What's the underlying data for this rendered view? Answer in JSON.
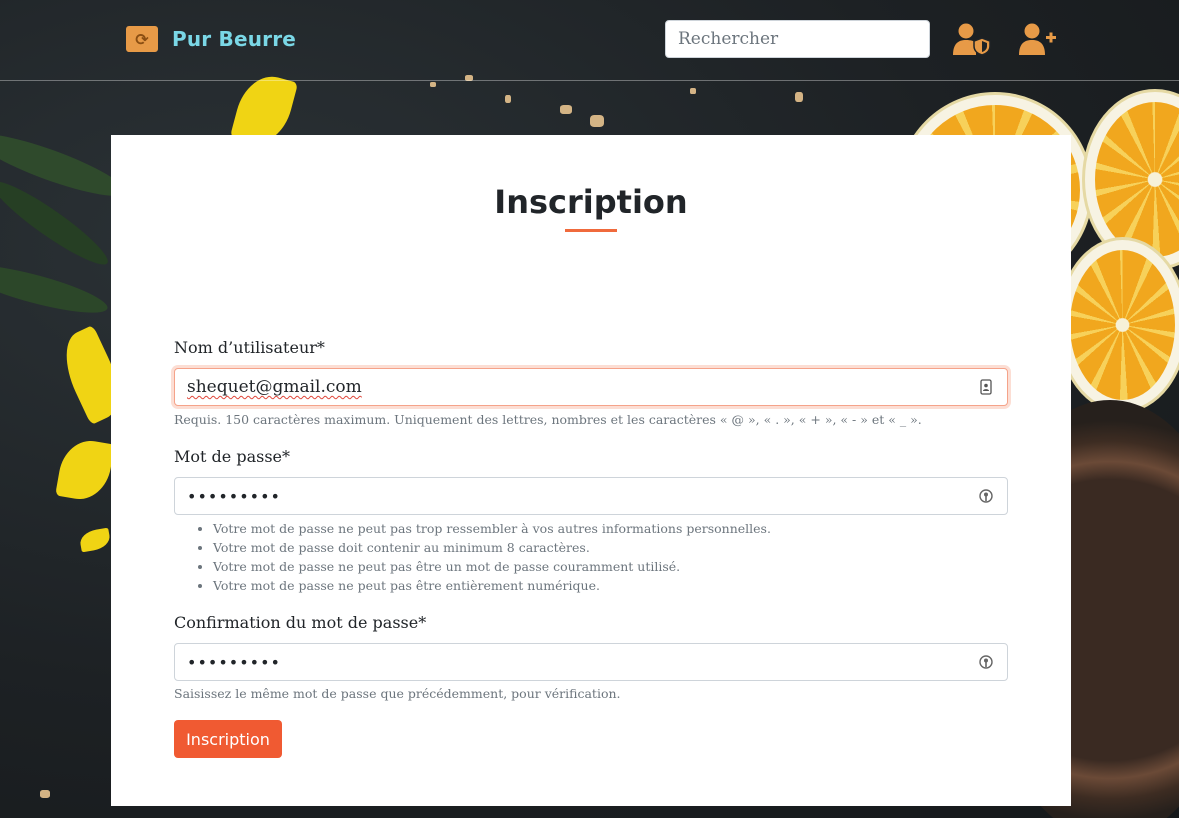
{
  "colors": {
    "brand_text": "#7ad7e6",
    "icon_orange": "#e79a47",
    "accent": "#f06a3c",
    "button_bg": "#f05a32"
  },
  "navbar": {
    "brand_name": "Pur Beurre",
    "brand_icon": "refresh-logo-icon",
    "search": {
      "placeholder": "Rechercher",
      "value": ""
    },
    "icons": [
      "user-shield-icon",
      "user-plus-icon"
    ]
  },
  "form": {
    "title": "Inscription",
    "username": {
      "label": "Nom d’utilisateur*",
      "value": "shequet@gmail.com",
      "help": "Requis. 150 caractères maximum. Uniquement des lettres, nombres et les caractères « @ », « . », « + », « - » et « _ »."
    },
    "password": {
      "label": "Mot de passe*",
      "value": "•••••••••",
      "help": [
        "Votre mot de passe ne peut pas trop ressembler à vos autres informations personnelles.",
        "Votre mot de passe doit contenir au minimum 8 caractères.",
        "Votre mot de passe ne peut pas être un mot de passe couramment utilisé.",
        "Votre mot de passe ne peut pas être entièrement numérique."
      ]
    },
    "password_confirm": {
      "label": "Confirmation du mot de passe*",
      "value": "•••••••••",
      "help": "Saisissez le même mot de passe que précédemment, pour vérification."
    },
    "submit_label": "Inscription"
  }
}
